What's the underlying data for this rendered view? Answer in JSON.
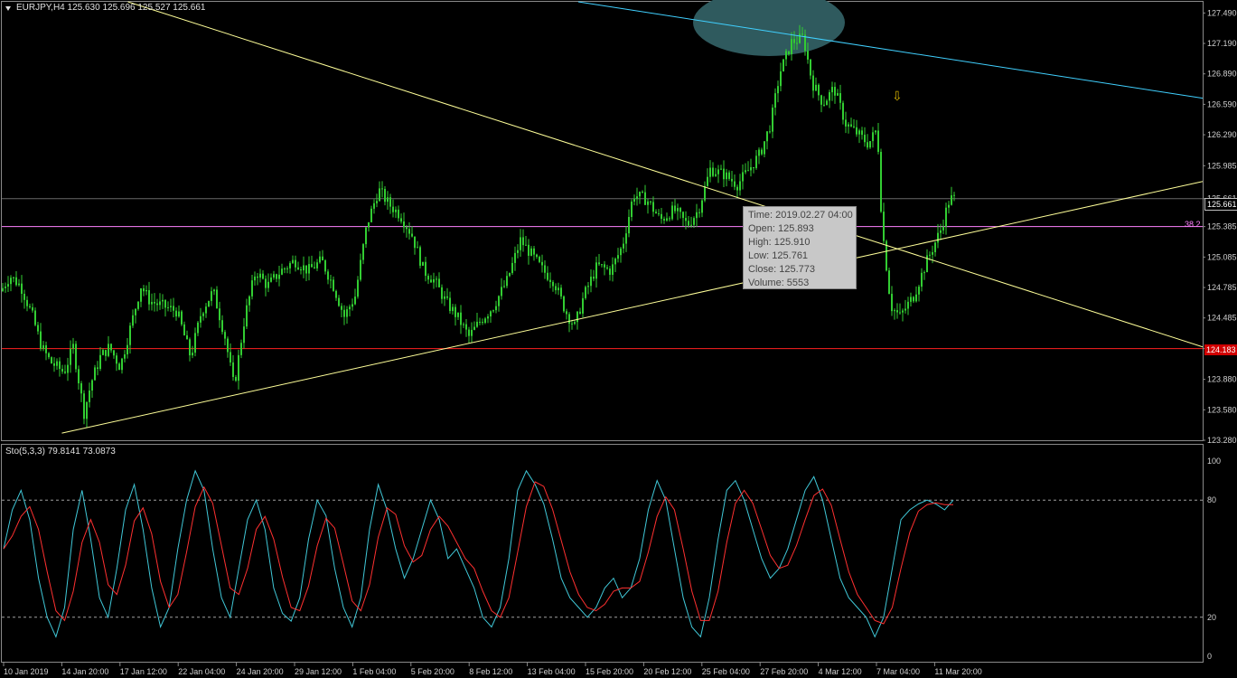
{
  "header": {
    "symbol": "EURJPY,H4",
    "ohlc": "125.630 125.696 125.527 125.661"
  },
  "price_axis": {
    "labels": [
      "127.490",
      "127.190",
      "126.890",
      "126.590",
      "126.290",
      "125.985",
      "125.661",
      "125.385",
      "125.085",
      "124.785",
      "124.485",
      "124.183",
      "123.880",
      "123.580",
      "123.280"
    ],
    "current_price": "125.661",
    "horizontal_line_price": "124.183",
    "fib_label": "38.2"
  },
  "time_axis": {
    "labels": [
      "10 Jan 2019",
      "14 Jan 20:00",
      "17 Jan 12:00",
      "22 Jan 04:00",
      "24 Jan 20:00",
      "29 Jan 12:00",
      "1 Feb 04:00",
      "5 Feb 20:00",
      "8 Feb 12:00",
      "13 Feb 04:00",
      "15 Feb 20:00",
      "20 Feb 12:00",
      "25 Feb 04:00",
      "27 Feb 20:00",
      "4 Mar 12:00",
      "7 Mar 04:00",
      "11 Mar 20:00"
    ]
  },
  "tooltip": {
    "time": "Time: 2019.02.27 04:00",
    "open": "Open: 125.893",
    "high": "High: 125.910",
    "low": "Low:  125.761",
    "close": "Close: 125.773",
    "volume": "Volume: 5553"
  },
  "stochastic": {
    "title": "Sto(5,3,3) 79.8141 73.0873",
    "levels": [
      "100",
      "80",
      "20",
      "0"
    ]
  },
  "colors": {
    "background": "#000000",
    "candle": "#32cd32",
    "trendline": "#ffff99",
    "channel_line": "#40d0ff",
    "support_line": "#ff2020",
    "fib_line": "#ff80ff",
    "main_line": "#40c8d8",
    "signal_line": "#ff3030"
  },
  "chart_data": {
    "type": "candlestick",
    "symbol": "EURJPY",
    "timeframe": "H4",
    "y_range": [
      123.28,
      127.6
    ],
    "close_path": [
      [
        0,
        124.75
      ],
      [
        10,
        124.9
      ],
      [
        22,
        124.8
      ],
      [
        35,
        124.5
      ],
      [
        45,
        124.2
      ],
      [
        55,
        124.05
      ],
      [
        70,
        123.95
      ],
      [
        80,
        124.2
      ],
      [
        92,
        123.55
      ],
      [
        100,
        123.85
      ],
      [
        110,
        124.1
      ],
      [
        120,
        124.2
      ],
      [
        132,
        124.0
      ],
      [
        145,
        124.45
      ],
      [
        155,
        124.8
      ],
      [
        165,
        124.65
      ],
      [
        180,
        124.6
      ],
      [
        195,
        124.55
      ],
      [
        210,
        124.1
      ],
      [
        222,
        124.55
      ],
      [
        235,
        124.75
      ],
      [
        248,
        124.3
      ],
      [
        258,
        123.8
      ],
      [
        270,
        124.5
      ],
      [
        282,
        124.95
      ],
      [
        295,
        124.8
      ],
      [
        310,
        124.95
      ],
      [
        325,
        125.05
      ],
      [
        340,
        124.95
      ],
      [
        355,
        125.05
      ],
      [
        368,
        124.8
      ],
      [
        380,
        124.5
      ],
      [
        392,
        124.7
      ],
      [
        405,
        125.4
      ],
      [
        418,
        125.75
      ],
      [
        430,
        125.6
      ],
      [
        442,
        125.5
      ],
      [
        455,
        125.3
      ],
      [
        468,
        124.95
      ],
      [
        480,
        124.85
      ],
      [
        492,
        124.65
      ],
      [
        505,
        124.5
      ],
      [
        518,
        124.3
      ],
      [
        530,
        124.45
      ],
      [
        545,
        124.6
      ],
      [
        560,
        124.85
      ],
      [
        575,
        125.25
      ],
      [
        588,
        125.1
      ],
      [
        600,
        124.95
      ],
      [
        612,
        124.85
      ],
      [
        625,
        124.55
      ],
      [
        635,
        124.4
      ],
      [
        645,
        124.7
      ],
      [
        660,
        125.0
      ],
      [
        675,
        124.95
      ],
      [
        688,
        125.2
      ],
      [
        700,
        125.7
      ],
      [
        715,
        125.65
      ],
      [
        730,
        125.45
      ],
      [
        745,
        125.55
      ],
      [
        760,
        125.4
      ],
      [
        772,
        125.55
      ],
      [
        785,
        125.95
      ],
      [
        800,
        125.9
      ],
      [
        815,
        125.8
      ],
      [
        828,
        125.95
      ],
      [
        840,
        126.1
      ],
      [
        852,
        126.4
      ],
      [
        862,
        126.9
      ],
      [
        875,
        127.2
      ],
      [
        888,
        127.25
      ],
      [
        898,
        126.8
      ],
      [
        910,
        126.6
      ],
      [
        922,
        126.75
      ],
      [
        935,
        126.4
      ],
      [
        948,
        126.3
      ],
      [
        960,
        126.2
      ],
      [
        970,
        126.35
      ],
      [
        975,
        125.4
      ],
      [
        985,
        124.6
      ],
      [
        995,
        124.5
      ],
      [
        1010,
        124.7
      ],
      [
        1025,
        125.05
      ],
      [
        1040,
        125.35
      ],
      [
        1050,
        125.66
      ]
    ],
    "trendlines": [
      {
        "color": "yellow",
        "from": [
          0.05,
          123.35
        ],
        "to": [
          1.0,
          125.83
        ]
      },
      {
        "color": "yellow",
        "from": [
          0.105,
          127.6
        ],
        "to": [
          1.0,
          124.2
        ]
      },
      {
        "color": "cyan",
        "from": [
          0.48,
          127.6
        ],
        "to": [
          1.0,
          126.65
        ]
      }
    ],
    "horizontal_levels": [
      125.661,
      125.385,
      124.183
    ],
    "stochastic": {
      "params": "5,3,3",
      "main_value": 79.8141,
      "signal_value": 73.0873,
      "levels": [
        80,
        20
      ],
      "y_range": [
        0,
        100
      ],
      "main": [
        55,
        75,
        85,
        70,
        40,
        20,
        10,
        25,
        65,
        85,
        60,
        30,
        20,
        45,
        75,
        88,
        65,
        35,
        15,
        25,
        55,
        80,
        95,
        85,
        55,
        30,
        20,
        45,
        70,
        80,
        65,
        35,
        22,
        18,
        30,
        60,
        80,
        72,
        45,
        25,
        15,
        30,
        65,
        88,
        75,
        55,
        40,
        50,
        65,
        80,
        70,
        50,
        55,
        45,
        35,
        20,
        15,
        25,
        50,
        85,
        95,
        88,
        78,
        60,
        40,
        30,
        25,
        20,
        25,
        35,
        40,
        30,
        35,
        50,
        75,
        90,
        80,
        55,
        30,
        15,
        10,
        30,
        60,
        85,
        90,
        80,
        65,
        50,
        40,
        45,
        55,
        70,
        85,
        92,
        80,
        60,
        40,
        30,
        25,
        20,
        10,
        20,
        45,
        70,
        75,
        78,
        80,
        78,
        75,
        80
      ]
    }
  }
}
